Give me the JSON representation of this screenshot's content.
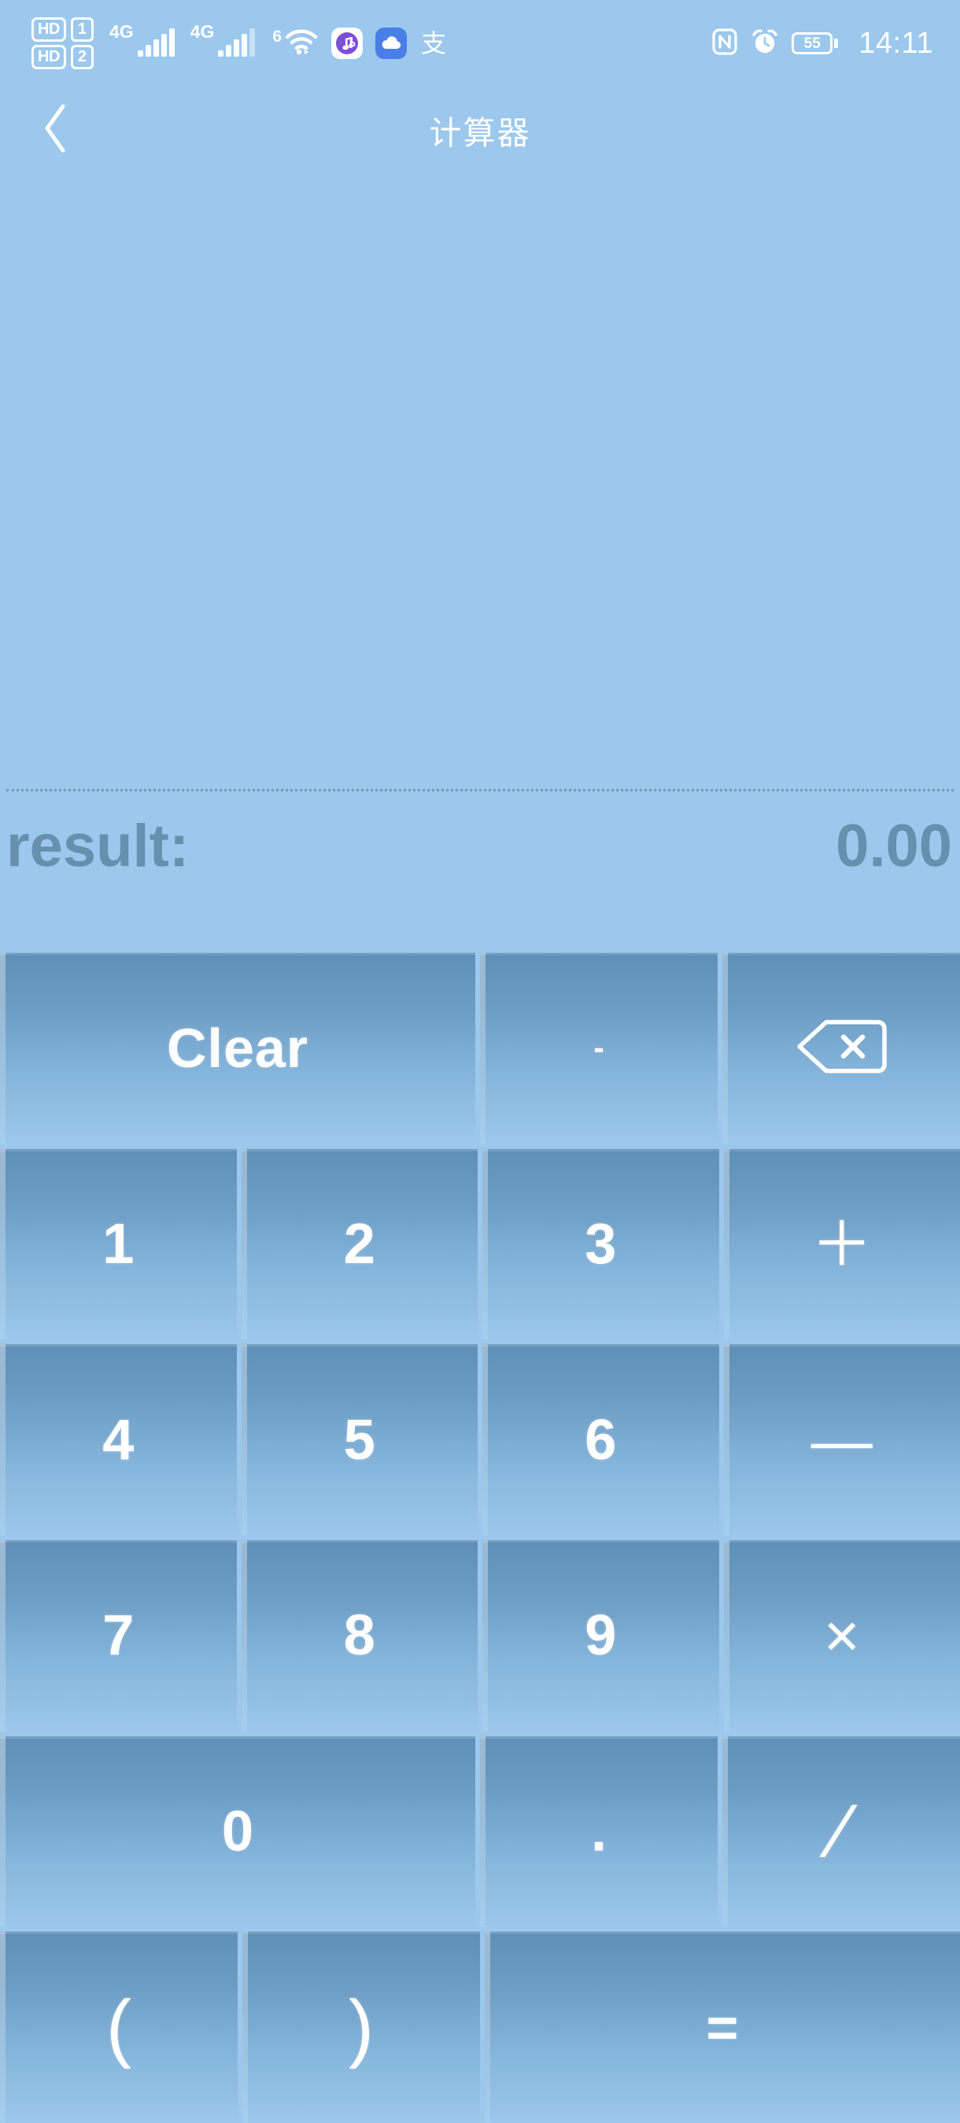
{
  "statusbar": {
    "volte": [
      {
        "hd": "HD",
        "sim": "1"
      },
      {
        "hd": "HD",
        "sim": "2"
      }
    ],
    "signals": [
      {
        "network": "4G",
        "icon": "signal-bars-icon"
      },
      {
        "network": "4G",
        "icon": "signal-bars-icon"
      }
    ],
    "wifi": {
      "generation": "6",
      "icon": "wifi-icon"
    },
    "app_icons": [
      {
        "name": "music-app-icon",
        "glyph": "♫",
        "color": "#7b4fd6"
      },
      {
        "name": "cloud-app-icon",
        "glyph": "☁",
        "color": "#4a7fe8"
      },
      {
        "name": "alipay-icon",
        "glyph": "支",
        "color": "#ffffff"
      }
    ],
    "nfc_icon": "nfc-icon",
    "alarm_icon": "alarm-clock-icon",
    "battery": {
      "level": "55",
      "icon": "battery-icon"
    },
    "time": "14:11"
  },
  "titlebar": {
    "back_icon": "back-chevron-icon",
    "title": "计算器"
  },
  "display": {
    "expression": "",
    "result_label": "result:",
    "result_value": "0.00"
  },
  "keypad": {
    "rows": [
      [
        {
          "key": "clear",
          "label": "Clear",
          "style": "word",
          "span": 2
        },
        {
          "key": "negate",
          "label": "-",
          "style": "dash",
          "span": 1
        },
        {
          "key": "backspace",
          "label": "",
          "style": "icon",
          "span": 1,
          "icon": "backspace-icon"
        }
      ],
      [
        {
          "key": "digit-1",
          "label": "1",
          "style": "num",
          "span": 1
        },
        {
          "key": "digit-2",
          "label": "2",
          "style": "num",
          "span": 1
        },
        {
          "key": "digit-3",
          "label": "3",
          "style": "num",
          "span": 1
        },
        {
          "key": "plus",
          "label": "＋",
          "style": "sym",
          "span": 1
        }
      ],
      [
        {
          "key": "digit-4",
          "label": "4",
          "style": "num",
          "span": 1
        },
        {
          "key": "digit-5",
          "label": "5",
          "style": "num",
          "span": 1
        },
        {
          "key": "digit-6",
          "label": "6",
          "style": "num",
          "span": 1
        },
        {
          "key": "minus",
          "label": "—",
          "style": "sym",
          "span": 1
        }
      ],
      [
        {
          "key": "digit-7",
          "label": "7",
          "style": "num",
          "span": 1
        },
        {
          "key": "digit-8",
          "label": "8",
          "style": "num",
          "span": 1
        },
        {
          "key": "digit-9",
          "label": "9",
          "style": "num",
          "span": 1
        },
        {
          "key": "multiply",
          "label": "×",
          "style": "sym",
          "span": 1
        }
      ],
      [
        {
          "key": "digit-0",
          "label": "0",
          "style": "num",
          "span": 2
        },
        {
          "key": "decimal",
          "label": ".",
          "style": "num",
          "span": 1
        },
        {
          "key": "divide",
          "label": "∕",
          "style": "slash",
          "span": 1
        }
      ],
      [
        {
          "key": "paren-open",
          "label": "(",
          "style": "paren",
          "span": 1
        },
        {
          "key": "paren-close",
          "label": ")",
          "style": "paren",
          "span": 1
        },
        {
          "key": "equals",
          "label": "=",
          "style": "eq",
          "span": 2
        }
      ]
    ]
  },
  "colors": {
    "background": "#9bc8ec",
    "key_top": "#5f8fb7",
    "key_bottom": "#9bc8ec",
    "key_text": "#ffffff",
    "result_text": "#678fae",
    "title_text": "#ffffff"
  }
}
